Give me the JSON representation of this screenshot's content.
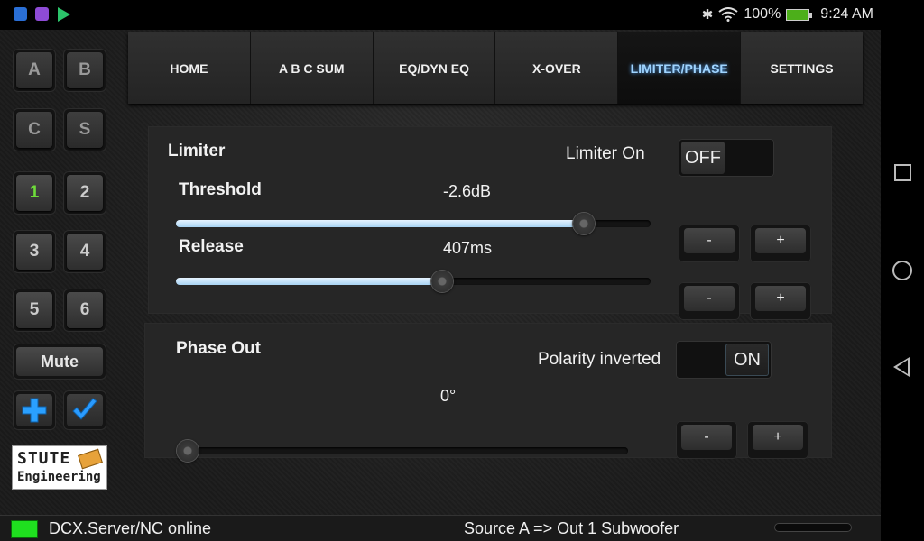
{
  "statusbar": {
    "battery_percent": "100%",
    "time": "9:24 AM",
    "icons": [
      "usb-icon",
      "gallery-icon",
      "play-store-icon",
      "bluetooth-icon",
      "wifi-icon",
      "battery-icon"
    ]
  },
  "sidebar": {
    "buttons": [
      {
        "label": "A"
      },
      {
        "label": "B"
      },
      {
        "label": "C"
      },
      {
        "label": "S"
      },
      {
        "label": "1",
        "selected": true
      },
      {
        "label": "2"
      },
      {
        "label": "3"
      },
      {
        "label": "4"
      },
      {
        "label": "5"
      },
      {
        "label": "6"
      }
    ],
    "mute_label": "Mute",
    "logo_line1": "STUTE",
    "logo_line2": "Engineering"
  },
  "tabs": [
    {
      "label": "HOME"
    },
    {
      "label": "A B C SUM"
    },
    {
      "label": "EQ/DYN EQ"
    },
    {
      "label": "X-OVER"
    },
    {
      "label": "LIMITER/PHASE",
      "active": true
    },
    {
      "label": "SETTINGS"
    }
  ],
  "limiter": {
    "title": "Limiter",
    "switch_label": "Limiter On",
    "switch_state": "OFF",
    "threshold": {
      "label": "Threshold",
      "value": "-2.6dB",
      "level_fraction": 0.86
    },
    "release": {
      "label": "Release",
      "value": "407ms",
      "level_fraction": 0.56
    },
    "minus_label": "-",
    "plus_label": "+"
  },
  "phase": {
    "title": "Phase Out",
    "switch_label": "Polarity inverted",
    "switch_state": "ON",
    "value": "0°",
    "level_fraction": 0.0,
    "minus_label": "-",
    "plus_label": "+"
  },
  "footer": {
    "connection": "DCX.Server/NC online",
    "routing": "Source A => Out 1 Subwoofer",
    "led_color": "#1fe01f"
  },
  "colors": {
    "accent_tab": "#9fd4ff",
    "selected_channel": "#6edc3a",
    "slider_fill": "#bfe0f7"
  }
}
